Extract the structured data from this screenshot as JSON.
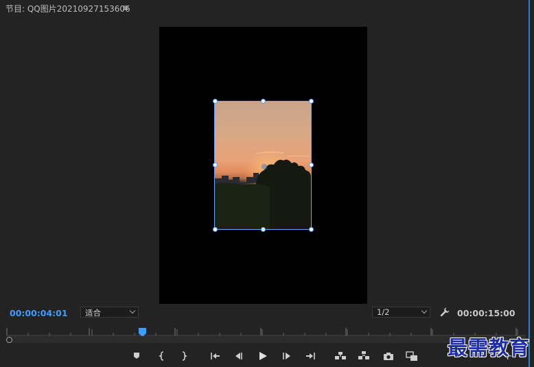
{
  "header": {
    "title": "节目: QQ图片20210927153606",
    "menu_icon": "hamburger-icon"
  },
  "monitor": {
    "current_timecode": "00:00:04:01",
    "fit_select": {
      "value": "适合"
    },
    "resolution_select": {
      "value": "1/2"
    },
    "duration_timecode": "00:00:15:00",
    "settings_icon": "wrench-icon"
  },
  "timeline": {
    "playhead_position": 0.2695
  },
  "transport": {
    "buttons": [
      "add-marker",
      "mark-in",
      "mark-out",
      "go-to-in",
      "step-back",
      "play",
      "step-forward",
      "go-to-out",
      "lift",
      "extract",
      "export-frame",
      "comparison-view",
      "button-editor"
    ]
  },
  "watermark": {
    "text": "最需教育"
  },
  "colors": {
    "accent": "#3e9cff",
    "selection": "#6aa6ff",
    "watermark": "#1d2ea8"
  }
}
